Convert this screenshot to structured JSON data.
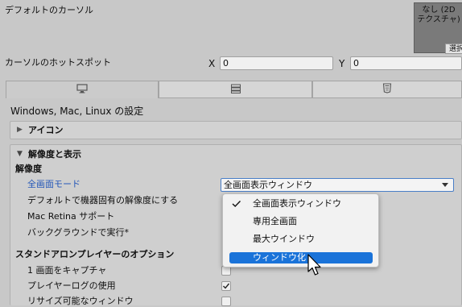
{
  "cursor": {
    "default_label": "デフォルトのカーソル",
    "texture_text": "なし (2D\nテクスチャ)",
    "select_button": "選択",
    "hotspot_label": "カーソルのホットスポット",
    "x_label": "X",
    "x_value": "0",
    "y_label": "Y",
    "y_value": "0"
  },
  "tabs": [
    {
      "icon": "monitor-icon",
      "active": true
    },
    {
      "icon": "server-icon",
      "active": false
    },
    {
      "icon": "html5-icon",
      "active": false
    }
  ],
  "platform_settings_title": "Windows, Mac, Linux の設定",
  "icon_section": {
    "label": "アイコン",
    "expanded": false
  },
  "resolution_section": {
    "label": "解像度と表示",
    "expanded": true,
    "resolution_header": "解像度",
    "fullscreen_mode_label": "全画面モード",
    "fullscreen_mode_value": "全画面表示ウィンドウ",
    "native_resolution_label": "デフォルトで機器固有の解像度にする",
    "mac_retina_label": "Mac Retina サポート",
    "run_in_background_label": "バックグラウンドで実行*",
    "standalone_header": "スタンドアロンプレイヤーのオプション",
    "capture_single_screen_label": "1 画面をキャプチャ",
    "capture_single_screen_checked": false,
    "use_player_log_label": "プレイヤーログの使用",
    "use_player_log_checked": true,
    "resizable_window_label": "リサイズ可能なウィンドウ",
    "resizable_window_checked": false
  },
  "dropdown_menu": {
    "items": [
      {
        "label": "全画面表示ウィンドウ",
        "checked": true,
        "highlighted": false
      },
      {
        "label": "専用全画面",
        "checked": false,
        "highlighted": false
      },
      {
        "label": "最大ウインドウ",
        "checked": false,
        "highlighted": false
      },
      {
        "label": "ウィンドウ化",
        "checked": false,
        "highlighted": true
      }
    ]
  },
  "colors": {
    "accent": "#1a73d9",
    "link_blue": "#2457b8",
    "background": "#c8c8c8"
  }
}
